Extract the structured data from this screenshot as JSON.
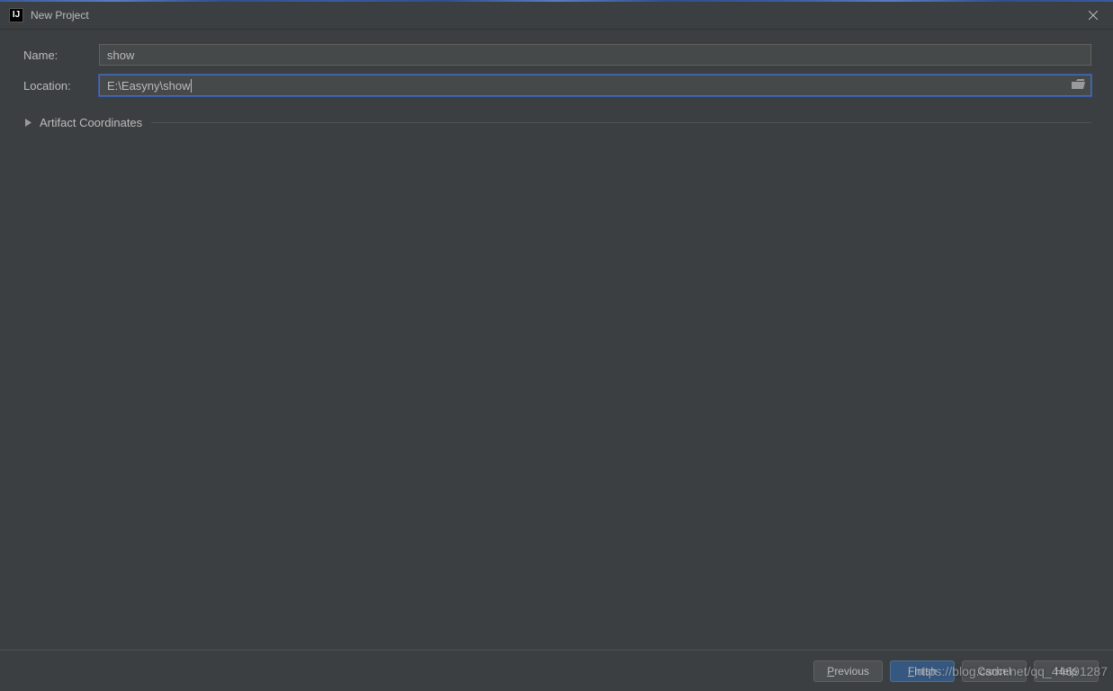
{
  "window": {
    "title": "New Project",
    "app_icon_text": "IJ"
  },
  "form": {
    "name_label": "Name:",
    "name_value": "show",
    "location_label": "Location:",
    "location_value": "E:\\Easyny\\show"
  },
  "expander": {
    "label": "Artifact Coordinates",
    "expanded": false
  },
  "buttons": {
    "previous": "Previous",
    "finish": "Finish",
    "cancel": "Cancel",
    "help": "Help"
  },
  "watermark": "https://blog.csdn.net/qq_44691287"
}
